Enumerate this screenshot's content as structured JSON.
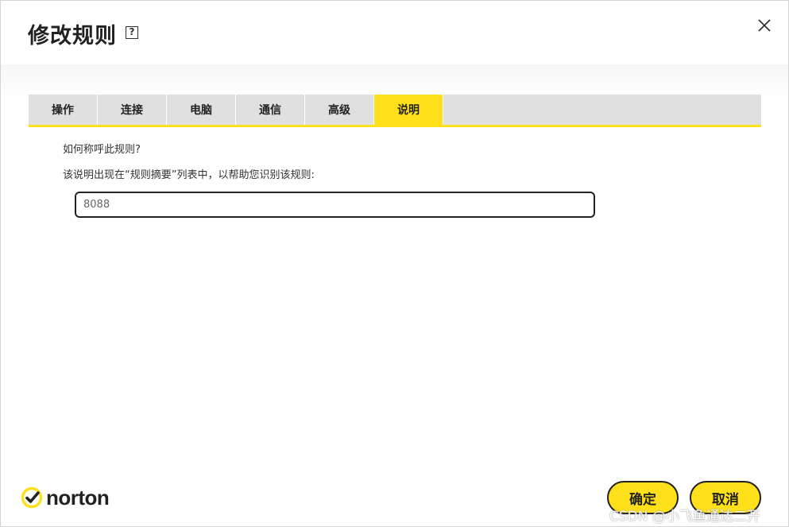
{
  "dialog": {
    "title": "修改规则",
    "help_icon": "question-box-icon",
    "close_icon": "close-icon",
    "help_glyph": "?",
    "close_glyph": "✕"
  },
  "tabs": [
    {
      "label": "操作",
      "active": false
    },
    {
      "label": "连接",
      "active": false
    },
    {
      "label": "电脑",
      "active": false
    },
    {
      "label": "通信",
      "active": false
    },
    {
      "label": "高级",
      "active": false
    },
    {
      "label": "说明",
      "active": true
    }
  ],
  "content": {
    "question": "如何称呼此规则?",
    "hint": "该说明出现在“规则摘要”列表中，以帮助您识别该规则:",
    "description_value": "8088"
  },
  "footer": {
    "brand_name": "norton",
    "ok_label": "确定",
    "cancel_label": "取消"
  },
  "watermark": "CSDN @小飞鱼通达二开",
  "colors": {
    "accent": "#ffe01b",
    "tab_bg": "#e0e0e0",
    "text": "#222222",
    "border": "#222222"
  }
}
